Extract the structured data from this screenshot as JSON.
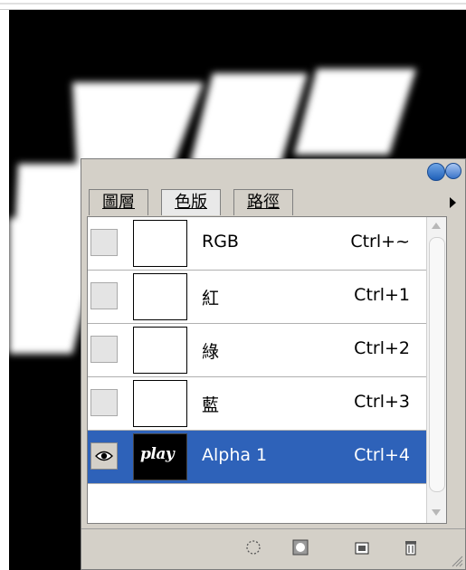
{
  "canvas": {
    "background": "#000000",
    "art_color": "#ffffff"
  },
  "panel": {
    "tabs": [
      {
        "label": "圖層",
        "active": false
      },
      {
        "label": "色版",
        "active": true
      },
      {
        "label": "路徑",
        "active": false
      }
    ],
    "channels": [
      {
        "name": "RGB",
        "shortcut": "Ctrl+~",
        "visible": false,
        "selected": false,
        "thumb": "white"
      },
      {
        "name": "紅",
        "shortcut": "Ctrl+1",
        "visible": false,
        "selected": false,
        "thumb": "white"
      },
      {
        "name": "綠",
        "shortcut": "Ctrl+2",
        "visible": false,
        "selected": false,
        "thumb": "white"
      },
      {
        "name": "藍",
        "shortcut": "Ctrl+3",
        "visible": false,
        "selected": false,
        "thumb": "white"
      },
      {
        "name": "Alpha 1",
        "shortcut": "Ctrl+4",
        "visible": true,
        "selected": true,
        "thumb": "alpha",
        "thumb_text": "play"
      }
    ],
    "selected_color": "#2e62b9",
    "bottom_tools": [
      "load-selection-icon",
      "save-selection-icon",
      "new-channel-icon",
      "trash-icon"
    ]
  }
}
